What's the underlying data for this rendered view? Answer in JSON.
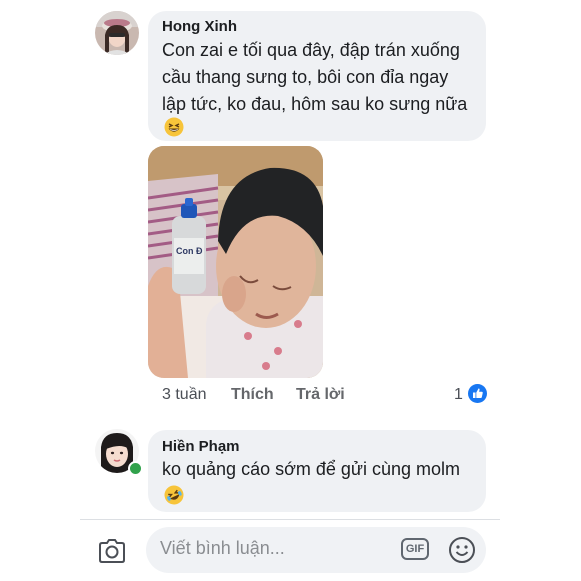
{
  "comments": [
    {
      "author": "Hong Xinh",
      "lines": [
        "Con zai e tối qua đây, đập trán xuống",
        "cầu thang sưng to, bôi con đỉa ngay",
        "lập tức, ko đau, hôm sau ko sưng nữa"
      ],
      "emoji": "grinning-squint-emoji",
      "photo_label": "Con Đ",
      "actions": {
        "time": "3 tuần",
        "like": "Thích",
        "reply": "Trả lời"
      },
      "reaction_count": "1",
      "reaction_icon": "like-icon"
    },
    {
      "author": "Hiền Phạm",
      "lines": [
        "ko quảng cáo sớm để gửi cùng molm"
      ],
      "emoji": "rolling-laughing-emoji",
      "online": true
    }
  ],
  "composer": {
    "placeholder": "Viết bình luận...",
    "gif_label": "GIF",
    "camera_icon": "camera-icon",
    "emoji_icon": "smiley-icon"
  },
  "colors": {
    "bubble": "#eff1f4",
    "like_blue": "#1877f2",
    "online_green": "#31a24c"
  }
}
